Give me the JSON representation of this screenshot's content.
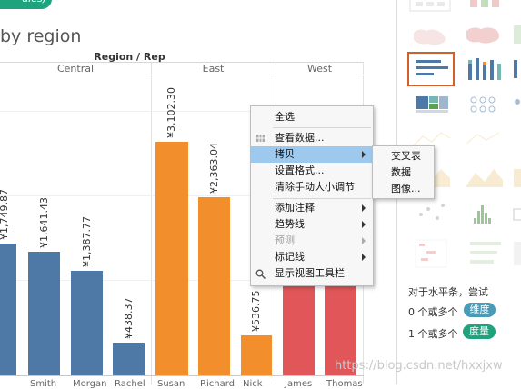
{
  "header": {
    "pill_text": "ales)",
    "sheet_title": "by region",
    "column_header": "Region / Rep",
    "regions": [
      "Central",
      "East",
      "West"
    ]
  },
  "chart_data": {
    "type": "bar",
    "currency_prefix": "¥",
    "bars": [
      {
        "region": "Central",
        "rep": "",
        "value": "1,749.87",
        "amount": 1749.87,
        "color": "#4e79a7"
      },
      {
        "region": "Central",
        "rep": "Smith",
        "value": "1,641.43",
        "amount": 1641.43,
        "color": "#4e79a7"
      },
      {
        "region": "Central",
        "rep": "Morgan",
        "value": "1,387.77",
        "amount": 1387.77,
        "color": "#4e79a7"
      },
      {
        "region": "Central",
        "rep": "Rachel",
        "value": "438.37",
        "amount": 438.37,
        "color": "#4e79a7"
      },
      {
        "region": "East",
        "rep": "Susan",
        "value": "3,102.30",
        "amount": 3102.3,
        "color": "#f28e2b"
      },
      {
        "region": "East",
        "rep": "Richard",
        "value": "2,363.04",
        "amount": 2363.04,
        "color": "#f28e2b"
      },
      {
        "region": "East",
        "rep": "Nick",
        "value": "536.75",
        "amount": 536.75,
        "color": "#f28e2b"
      },
      {
        "region": "West",
        "rep": "James",
        "value": "",
        "amount": 1250,
        "color": "#e15759"
      },
      {
        "region": "West",
        "rep": "Thomas",
        "value": "",
        "amount": 1250,
        "color": "#e15759"
      }
    ]
  },
  "context_menu": {
    "items": [
      {
        "label": "全选",
        "submenu": false,
        "disabled": false,
        "highlighted": false
      },
      {
        "label": "查看数据...",
        "submenu": false,
        "disabled": false,
        "highlighted": false,
        "icon": "grid-icon"
      },
      {
        "label": "拷贝",
        "submenu": true,
        "disabled": false,
        "highlighted": true
      },
      {
        "label": "设置格式...",
        "submenu": false,
        "disabled": false,
        "highlighted": false
      },
      {
        "label": "清除手动大小调节",
        "submenu": false,
        "disabled": false,
        "highlighted": false
      },
      {
        "label": "添加注释",
        "submenu": true,
        "disabled": false,
        "highlighted": false
      },
      {
        "label": "趋势线",
        "submenu": true,
        "disabled": false,
        "highlighted": false
      },
      {
        "label": "预测",
        "submenu": true,
        "disabled": true,
        "highlighted": false
      },
      {
        "label": "标记线",
        "submenu": true,
        "disabled": false,
        "highlighted": false
      },
      {
        "label": "显示视图工具栏",
        "submenu": false,
        "disabled": false,
        "highlighted": false,
        "icon": "magnifier-icon"
      }
    ],
    "submenu_items": [
      "交叉表",
      "数据",
      "图像..."
    ]
  },
  "show_me": {
    "hint": "对于水平条，尝试",
    "dimension_prefix": "0 个或多个",
    "dimension_pill": "维度",
    "measure_prefix": "1 个或多个",
    "measure_pill": "度量",
    "dimension_color": "#4a9bb5",
    "measure_color": "#1fa37f",
    "selected_thumb_border": "#d35f2b"
  },
  "watermark": "https://blog.csdn.net/hxxjxw"
}
